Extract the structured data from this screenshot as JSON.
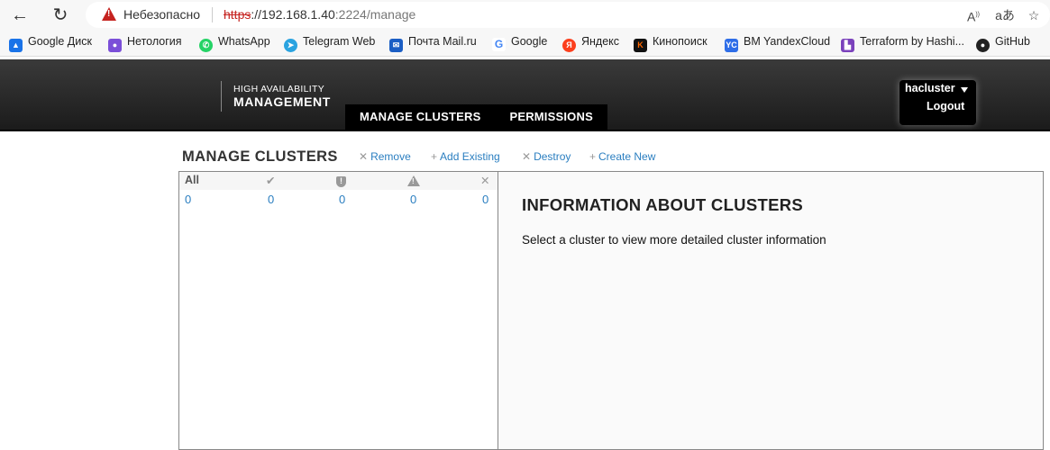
{
  "browser": {
    "insecure_label": "Небезопасно",
    "url_scheme": "https",
    "url_host": "://192.168.1.40",
    "url_rest": ":2224/manage",
    "read_aloud_icon": "read-aloud-icon",
    "translate_icon": "translate-icon",
    "favorite_icon": "add-favorite-icon"
  },
  "bookmarks": [
    {
      "label": "Google Диск",
      "color": "#1a73e8"
    },
    {
      "label": "Нетология",
      "color": "#7b4fd8"
    },
    {
      "label": "WhatsApp",
      "color": "#25d366"
    },
    {
      "label": "Telegram Web",
      "color": "#2aa3e0"
    },
    {
      "label": "Почта Mail.ru",
      "color": "#1b5ec4"
    },
    {
      "label": "Google",
      "color": "#4285f4"
    },
    {
      "label": "Яндекс",
      "color": "#fc3f1d"
    },
    {
      "label": "Кинопоиск",
      "color": "#111111"
    },
    {
      "label": "BM YandexCloud",
      "color": "#2f6ee8",
      "icon_text": "YC"
    },
    {
      "label": "Terraform by Hashi...",
      "color": "#7b42bc"
    },
    {
      "label": "GitHub",
      "color": "#222222"
    }
  ],
  "header": {
    "brand_top": "HIGH AVAILABILITY",
    "brand_bottom": "MANAGEMENT",
    "nav": [
      "MANAGE CLUSTERS",
      "PERMISSIONS"
    ],
    "username": "hacluster",
    "logout": "Logout"
  },
  "toolbar": {
    "title": "MANAGE CLUSTERS",
    "actions": [
      {
        "symbol": "✕",
        "label": "Remove"
      },
      {
        "symbol": "+",
        "label": "Add Existing"
      },
      {
        "symbol": "✕",
        "label": "Destroy"
      },
      {
        "symbol": "+",
        "label": "Create New"
      }
    ]
  },
  "cluster_list": {
    "all_label": "All",
    "counts": [
      "0",
      "0",
      "0",
      "0",
      "0"
    ]
  },
  "info": {
    "title": "INFORMATION ABOUT CLUSTERS",
    "text": "Select a cluster to view more detailed cluster information"
  },
  "colors": {
    "link": "#2a7ec0",
    "header_bg": "#2a2a2a",
    "nav_bg": "#000000"
  }
}
